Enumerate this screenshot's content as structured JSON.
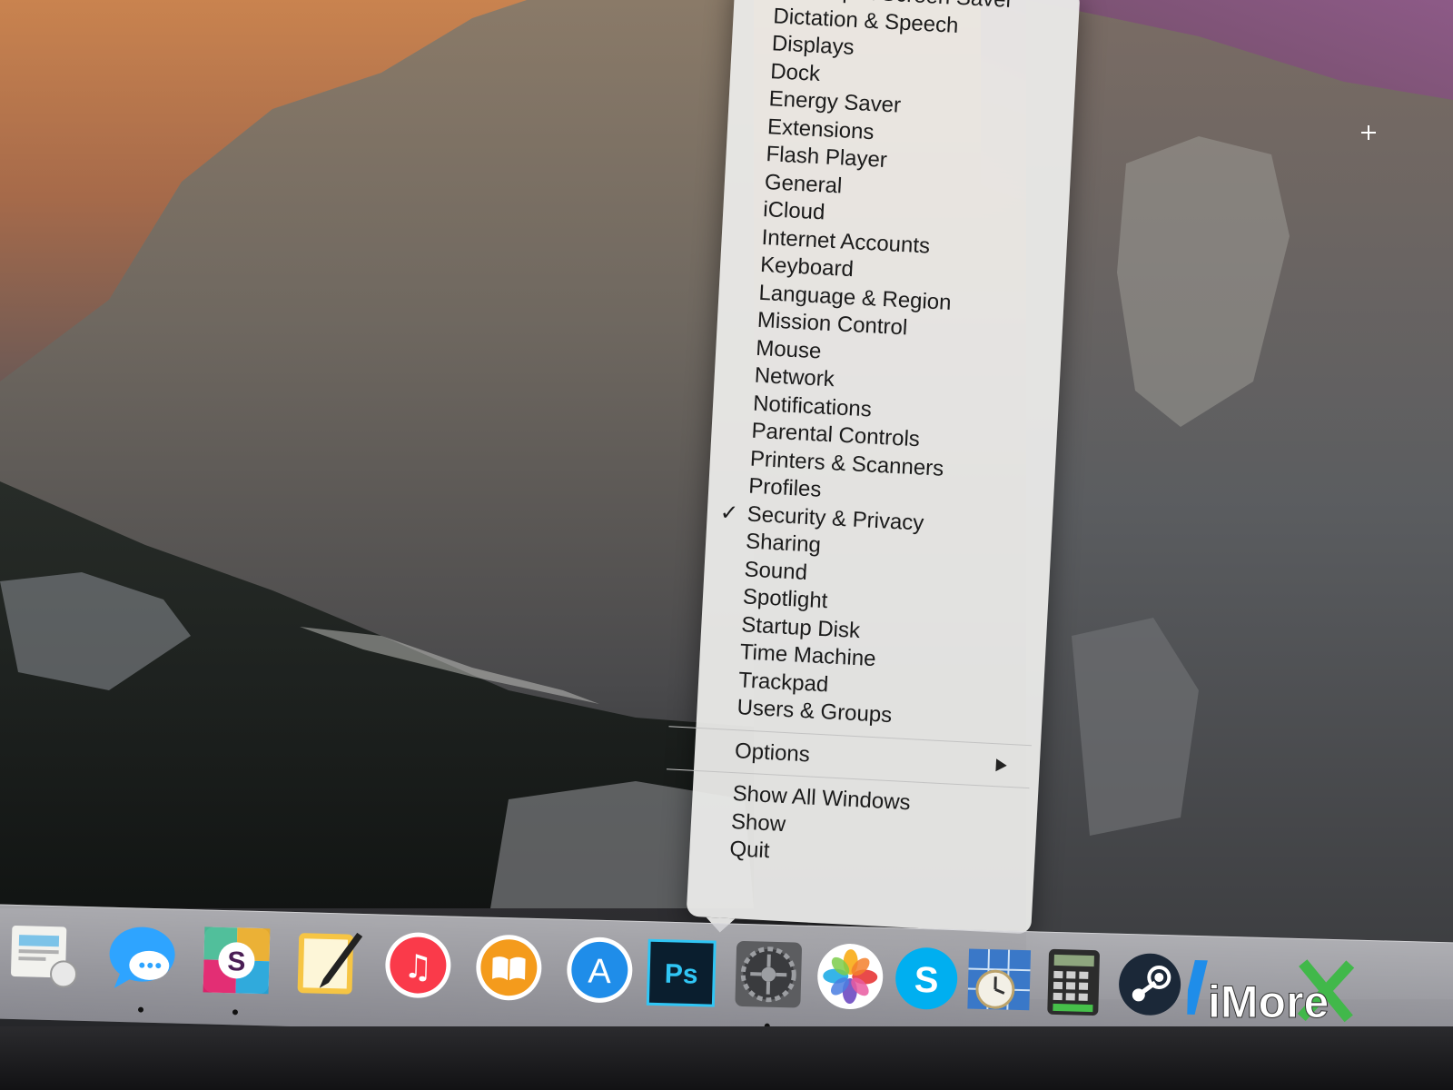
{
  "context_menu": {
    "items": [
      {
        "label": "Desktop & Screen Saver",
        "checked": false
      },
      {
        "label": "Dictation & Speech",
        "checked": false
      },
      {
        "label": "Displays",
        "checked": false
      },
      {
        "label": "Dock",
        "checked": false
      },
      {
        "label": "Energy Saver",
        "checked": false
      },
      {
        "label": "Extensions",
        "checked": false
      },
      {
        "label": "Flash Player",
        "checked": false
      },
      {
        "label": "General",
        "checked": false
      },
      {
        "label": "iCloud",
        "checked": false
      },
      {
        "label": "Internet Accounts",
        "checked": false
      },
      {
        "label": "Keyboard",
        "checked": false
      },
      {
        "label": "Language & Region",
        "checked": false
      },
      {
        "label": "Mission Control",
        "checked": false
      },
      {
        "label": "Mouse",
        "checked": false
      },
      {
        "label": "Network",
        "checked": false
      },
      {
        "label": "Notifications",
        "checked": false
      },
      {
        "label": "Parental Controls",
        "checked": false
      },
      {
        "label": "Printers & Scanners",
        "checked": false
      },
      {
        "label": "Profiles",
        "checked": false
      },
      {
        "label": "Security & Privacy",
        "checked": true
      },
      {
        "label": "Sharing",
        "checked": false
      },
      {
        "label": "Sound",
        "checked": false
      },
      {
        "label": "Spotlight",
        "checked": false
      },
      {
        "label": "Startup Disk",
        "checked": false
      },
      {
        "label": "Time Machine",
        "checked": false
      },
      {
        "label": "Trackpad",
        "checked": false
      },
      {
        "label": "Users & Groups",
        "checked": false
      }
    ],
    "check_glyph": "✓",
    "options_label": "Options",
    "actions": [
      "Show All Windows",
      "Show",
      "Quit"
    ]
  },
  "dock": {
    "items": [
      {
        "icon": "preview-icon",
        "running": false
      },
      {
        "icon": "messages-icon",
        "running": true
      },
      {
        "icon": "slack-icon",
        "label": "S",
        "running": true
      },
      {
        "icon": "notes-pencil-icon",
        "running": false
      },
      {
        "icon": "itunes-icon",
        "label": "♫",
        "running": false
      },
      {
        "icon": "ibooks-icon",
        "running": false
      },
      {
        "icon": "app-store-icon",
        "label": "A",
        "running": false
      },
      {
        "icon": "photoshop-icon",
        "label": "Ps",
        "running": false
      },
      {
        "icon": "system-preferences-icon",
        "running": true
      },
      {
        "icon": "photos-icon",
        "running": false
      },
      {
        "icon": "skype-icon",
        "label": "S",
        "running": false
      },
      {
        "icon": "time-zone-icon",
        "running": false
      },
      {
        "icon": "calculator-icon",
        "running": false
      },
      {
        "icon": "steam-icon",
        "running": false
      },
      {
        "icon": "app-icon",
        "running": false
      },
      {
        "icon": "app-icon-2",
        "running": false
      }
    ]
  },
  "watermark": {
    "text": "iMore"
  },
  "colors": {
    "menu_background": "#ececea",
    "menu_text": "#1b1b1b",
    "photoshop_bg": "#0a1e2e",
    "photoshop_fg": "#30c6f5",
    "skype_blue": "#00aff0",
    "appstore_blue": "#1f8de9",
    "itunes_red": "#fa3a4a"
  }
}
